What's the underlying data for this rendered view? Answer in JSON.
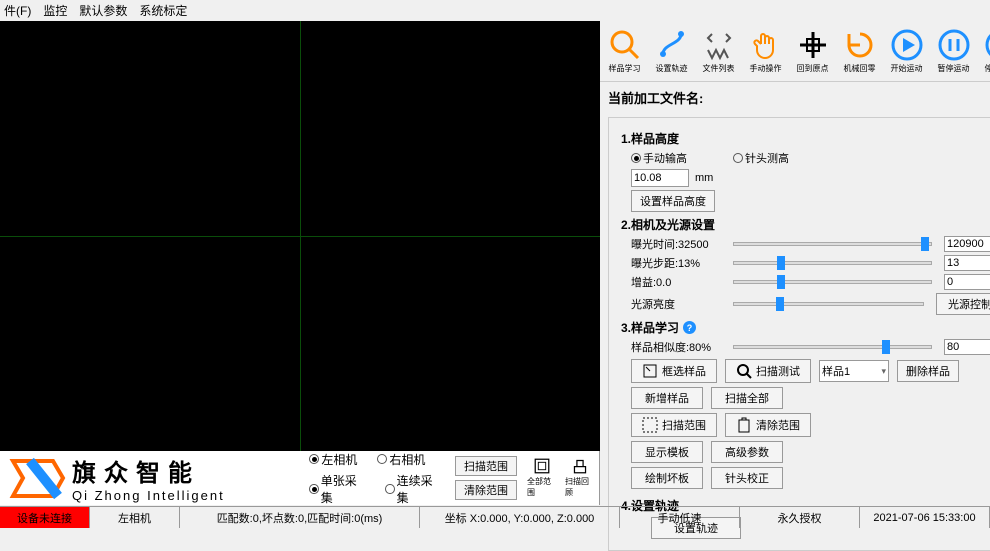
{
  "menubar": [
    "件(F)",
    "监控",
    "默认参数",
    "系统标定"
  ],
  "toolbar": [
    {
      "name": "sample-learn",
      "label": "样品学习",
      "color": "#ff8c00"
    },
    {
      "name": "set-track",
      "label": "设置轨迹",
      "color": "#1e90ff"
    },
    {
      "name": "file-list",
      "label": "文件列表",
      "color": "#555"
    },
    {
      "name": "manual-op",
      "label": "手动操作",
      "color": "#ff8c00"
    },
    {
      "name": "back-origin",
      "label": "回到原点",
      "color": "#000"
    },
    {
      "name": "machine-zero",
      "label": "机械回零",
      "color": "#ff8c00"
    },
    {
      "name": "start-run",
      "label": "开始运动",
      "color": "#1e90ff"
    },
    {
      "name": "pause-run",
      "label": "暂停运动",
      "color": "#1e90ff"
    },
    {
      "name": "stop-run",
      "label": "停止运动",
      "color": "#1e90ff"
    }
  ],
  "current_file_label": "当前加工文件名:",
  "step1": {
    "title": "1.样品高度",
    "r1": "手动输高",
    "r2": "针头测高",
    "height": "10.08",
    "unit": "mm",
    "set_btn": "设置样品高度"
  },
  "step2": {
    "title": "2.相机及光源设置",
    "exposure_time": {
      "label": "曝光时间:32500",
      "value": "120900",
      "thumb": 95
    },
    "exposure_step": {
      "label": "曝光步距:13%",
      "value": "13",
      "thumb": 22
    },
    "gain": {
      "label": "增益:0.0",
      "value": "0",
      "thumb": 22
    },
    "light": {
      "label": "光源亮度",
      "btn": "光源控制",
      "thumb": 22
    }
  },
  "step3": {
    "title": "3.样品学习",
    "sim": {
      "label": "样品相似度:80%",
      "value": "80",
      "thumb": 75
    }
  },
  "buttons": {
    "select_sample": "框选样品",
    "scan_test": "扫描测试",
    "combo": "样品1",
    "delete_sample": "删除样品",
    "new_sample": "新增样品",
    "scan_all": "扫描全部",
    "scan_range": "扫描范围",
    "clear_range": "清除范围",
    "show_template": "显示模板",
    "adv_param": "高级参数",
    "draw_bad": "绘制坏板",
    "needle_calib": "针头校正"
  },
  "step4": {
    "title": "4.设置轨迹",
    "btn": "设置轨迹"
  },
  "acq": {
    "cam_left": "左相机",
    "cam_right": "右相机",
    "single": "单张采集",
    "cont": "连续采集",
    "scan_range": "扫描范围",
    "clear_range": "清除范围",
    "full_range": "全部范围",
    "scan_frame": "扫描回顾"
  },
  "logo": {
    "cn": "旗众智能",
    "en": "Qi Zhong Intelligent"
  },
  "statusbar": {
    "conn": "设备未连接",
    "cam": "左相机",
    "match": "匹配数:0,坏点数:0,匹配时间:0(ms)",
    "coord": "坐标 X:0.000, Y:0.000, Z:0.000",
    "speed": "手动低速",
    "auth": "永久授权",
    "time": "2021-07-06 15:33:00"
  }
}
